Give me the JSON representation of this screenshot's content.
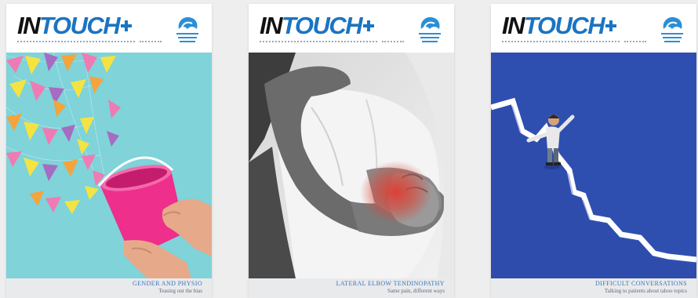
{
  "covers": [
    {
      "masthead": {
        "logo_prefix": "IN",
        "logo_main": "TOUCH"
      },
      "caption": {
        "title": "GENDER AND PHYSIO",
        "subtitle": "Teasing out the bias"
      }
    },
    {
      "masthead": {
        "logo_prefix": "IN",
        "logo_main": "TOUCH"
      },
      "caption": {
        "title": "LATERAL ELBOW TENDINOPATHY",
        "subtitle": "Same pain, different ways"
      }
    },
    {
      "masthead": {
        "logo_prefix": "IN",
        "logo_main": "TOUCH"
      },
      "caption": {
        "title": "DIFFICULT CONVERSATIONS",
        "subtitle": "Talking to patients about taboo topics"
      }
    }
  ],
  "colors": {
    "brand_blue": "#1b74c2",
    "cover1_background": "#7fd3d9",
    "cover2_highlight": "#e03a2f",
    "cover3_background": "#2f4fb0"
  },
  "icons": {
    "association_logo": "physio-association-logo",
    "cover1_art": "pink-bucket-with-bunting",
    "cover2_art": "man-holding-painful-elbow",
    "cover3_art": "man-balancing-on-falling-graph-line"
  }
}
